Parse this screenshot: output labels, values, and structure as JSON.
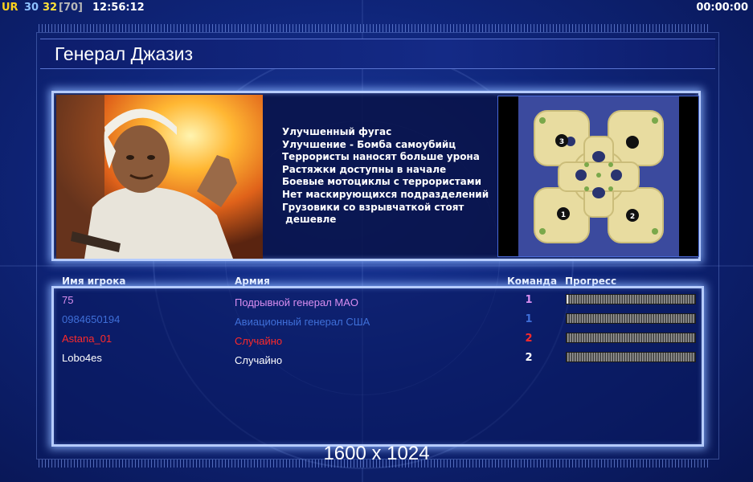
{
  "hud": {
    "ur": "UR",
    "value_30": "30",
    "value_32": "32",
    "value_70": "[70]",
    "clock": "12:56:12",
    "timer": "00:00:00"
  },
  "general": {
    "title": "Генерал Джазиз",
    "features": [
      "Улучшенный фугас",
      "Улучшение - Бомба самоубийц",
      "Террористы наносят больше урона",
      "Растяжки доступны в начале",
      "Боевые мотоциклы с террористами",
      "Нет маскирующихся подразделений",
      "Грузовики со взрывчаткой стоят",
      " дешевле"
    ]
  },
  "minimap": {
    "start_labels": [
      "3",
      "1",
      "2"
    ]
  },
  "roster": {
    "headers": {
      "player": "Имя игрока",
      "army": "Армия",
      "team": "Команда",
      "progress": "Прогресс"
    },
    "rows": [
      {
        "name": "75",
        "army": "Подрывной генерал MAO",
        "team": "1",
        "color": "#d98ef0",
        "progress": 0.01
      },
      {
        "name": "0984650194",
        "army": "Авиационный генерал США",
        "team": "1",
        "color": "#3f6fd8",
        "progress": 0
      },
      {
        "name": "Astana_01",
        "army": "Случайно",
        "team": "2",
        "color": "#ff2a2a",
        "progress": 0
      },
      {
        "name": "Lobo4es",
        "army": "Случайно",
        "team": "2",
        "color": "#ffffff",
        "progress": 0
      }
    ]
  },
  "resolution": "1600 x 1024"
}
